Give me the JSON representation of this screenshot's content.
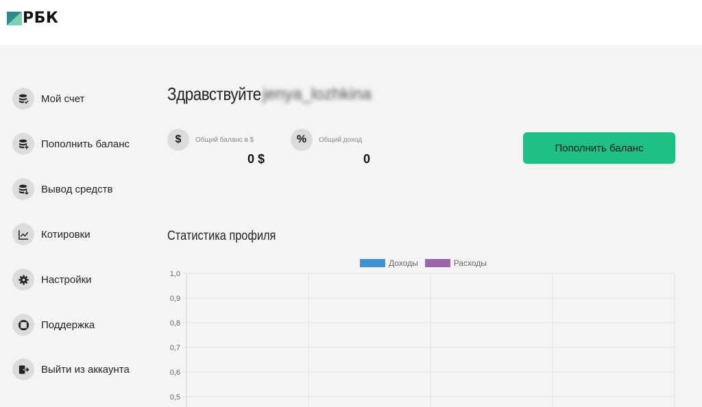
{
  "header": {
    "logo_text": "РБК"
  },
  "sidebar": {
    "items": [
      {
        "label": "Мой счет",
        "icon": "coins-check-icon"
      },
      {
        "label": "Пополнить баланс",
        "icon": "coins-plus-icon"
      },
      {
        "label": "Вывод средств",
        "icon": "coins-down-icon"
      },
      {
        "label": "Котировки",
        "icon": "chart-line-icon"
      },
      {
        "label": "Настройки",
        "icon": "gear-icon"
      },
      {
        "label": "Поддержка",
        "icon": "lifebuoy-icon"
      },
      {
        "label": "Выйти из аккаунта",
        "icon": "logout-icon"
      }
    ]
  },
  "main": {
    "greeting": "Здравствуйте",
    "username": "jenya_lozhkina",
    "stats": [
      {
        "icon_symbol": "$",
        "label": "Общий баланс в $",
        "value": "0 $"
      },
      {
        "icon_symbol": "%",
        "label": "Общий доход",
        "value": "0"
      }
    ],
    "topup_button": "Пополнить баланс",
    "section_title": "Статистика профиля"
  },
  "colors": {
    "accent": "#20c084",
    "income": "#3e95cd",
    "expense": "#9c64a8"
  },
  "chart_data": {
    "type": "line",
    "series": [
      {
        "name": "Доходы",
        "values": []
      },
      {
        "name": "Расходы",
        "values": []
      }
    ],
    "y_ticks": [
      "1,0",
      "0,9",
      "0,8",
      "0,7",
      "0,6",
      "0,5"
    ],
    "ylim": [
      0,
      1.0
    ],
    "x_gridlines": 4,
    "grid": true,
    "legend": "top-center"
  }
}
